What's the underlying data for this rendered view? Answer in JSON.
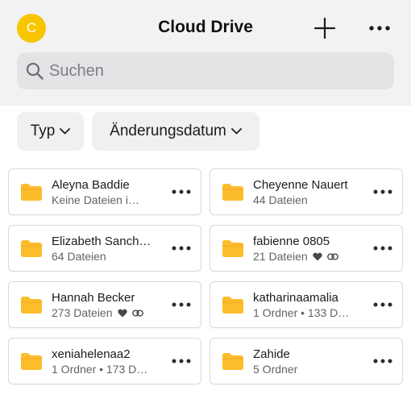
{
  "header": {
    "avatar_letter": "C",
    "title": "Cloud Drive",
    "icons": {
      "add": "plus-icon",
      "more": "ellipsis-icon",
      "search": "search-icon",
      "folder": "folder-icon",
      "favorite": "heart-icon",
      "shared": "link-icon"
    }
  },
  "search": {
    "placeholder": "Suchen",
    "value": ""
  },
  "filters": {
    "type_label": "Typ",
    "date_label": "Änderungsdatum"
  },
  "colors": {
    "accent": "#f7c600",
    "folder": "#fbbd2b",
    "background": "#f2f2f4"
  },
  "folders": [
    {
      "name": "Aleyna Baddie",
      "sub": "Keine Dateien i…",
      "favorite": false,
      "shared": false
    },
    {
      "name": "Cheyenne Nauert",
      "sub": "44 Dateien",
      "favorite": false,
      "shared": false
    },
    {
      "name": "Elizabeth Sanch…",
      "sub": "64 Dateien",
      "favorite": false,
      "shared": false
    },
    {
      "name": "fabienne 0805",
      "sub": "21 Dateien",
      "favorite": true,
      "shared": true
    },
    {
      "name": "Hannah Becker",
      "sub": "273 Dateien",
      "favorite": true,
      "shared": true
    },
    {
      "name": "katharinaamalia",
      "sub": "1 Ordner • 133 D…",
      "favorite": false,
      "shared": false
    },
    {
      "name": "xeniahelenaa2",
      "sub": "1 Ordner • 173 D…",
      "favorite": false,
      "shared": false
    },
    {
      "name": "Zahide",
      "sub": "5 Ordner",
      "favorite": false,
      "shared": false
    }
  ]
}
